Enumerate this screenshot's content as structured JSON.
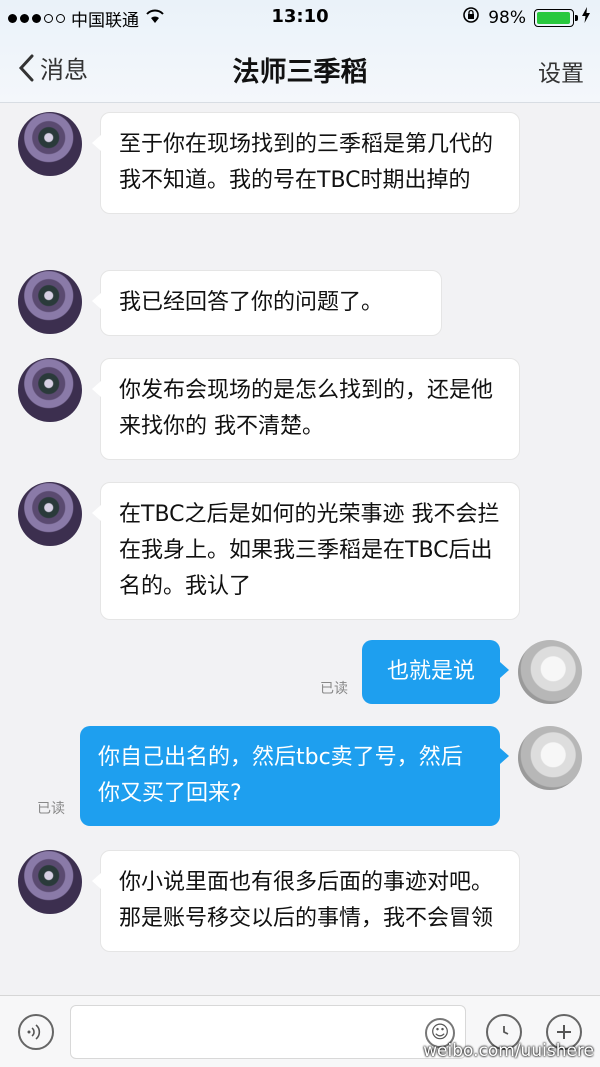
{
  "status": {
    "carrier": "中国联通",
    "time": "13:10",
    "battery": "98%",
    "battery_level": 0.98
  },
  "header": {
    "back_label": "消息",
    "title": "法师三季稻",
    "settings_label": "设置"
  },
  "messages": [
    {
      "from": "them",
      "text": "至于你在现场找到的三季稻是第几代的我不知道。我的号在TBC时期出掉的"
    },
    {
      "from": "them",
      "text": "我已经回答了你的问题了。"
    },
    {
      "from": "them",
      "text": "你发布会现场的是怎么找到的，还是他来找你的 我不清楚。"
    },
    {
      "from": "them",
      "text": "在TBC之后是如何的光荣事迹 我不会拦在我身上。如果我三季稻是在TBC后出名的。我认了"
    },
    {
      "from": "me",
      "text": "也就是说",
      "status": "已读"
    },
    {
      "from": "me",
      "text": "你自己出名的，然后tbc卖了号，然后你又买了回来?",
      "status": "已读"
    },
    {
      "from": "them",
      "text": "你小说里面也有很多后面的事迹对吧。那是账号移交以后的事情，我不会冒领"
    }
  ],
  "watermark": "weibo.com/uuishere",
  "icons": {
    "back": "chevron-left-icon",
    "voice": "voice-icon",
    "emoji": "emoji-icon",
    "clock": "clock-icon",
    "plus": "plus-icon",
    "wifi": "wifi-icon",
    "lock": "rotation-lock-icon",
    "charging": "charging-icon"
  },
  "colors": {
    "my_bubble": "#1e9fef",
    "their_bubble": "#ffffff",
    "battery": "#28c83d"
  }
}
